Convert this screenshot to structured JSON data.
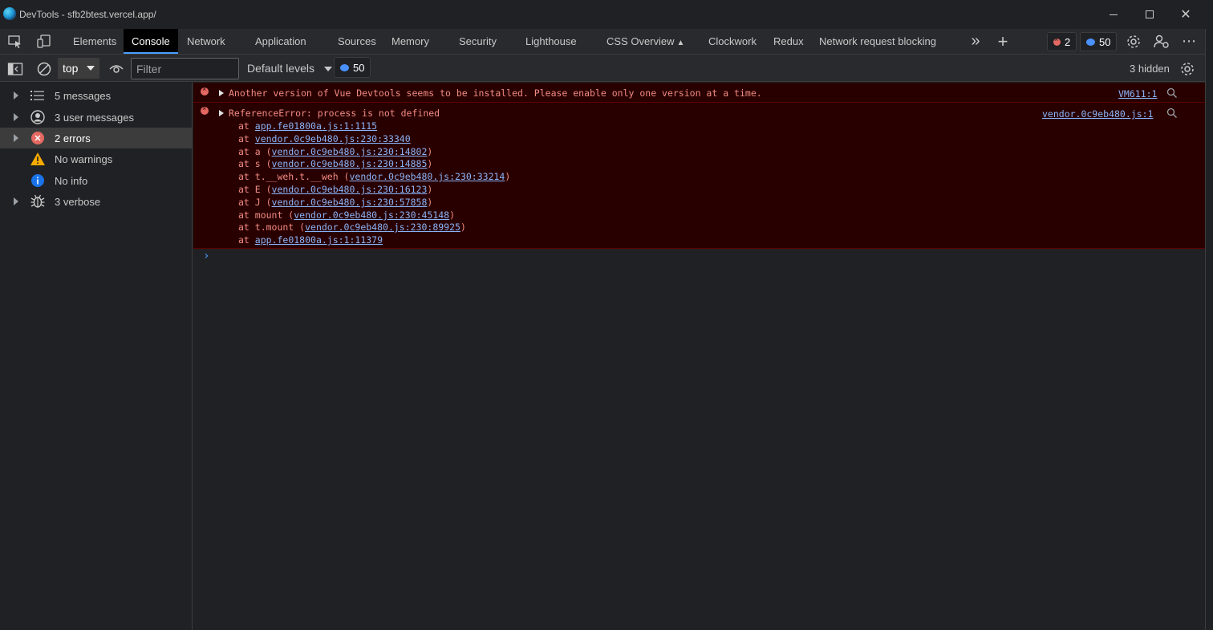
{
  "window": {
    "title": "DevTools - sfb2btest.vercel.app/",
    "minimize_icon": "minimize-icon",
    "maximize_icon": "maximize-icon",
    "close_glyph": "✕"
  },
  "tabs": [
    {
      "label": "Elements",
      "active": false
    },
    {
      "label": "Console",
      "active": true
    },
    {
      "label": "Network",
      "active": false
    },
    {
      "label": "Application",
      "active": false
    },
    {
      "label": "Sources",
      "active": false
    },
    {
      "label": "Memory",
      "active": false
    },
    {
      "label": "Security",
      "active": false
    },
    {
      "label": "Lighthouse",
      "active": false
    },
    {
      "label": "CSS Overview",
      "active": false
    },
    {
      "label": "Clockwork",
      "active": false
    },
    {
      "label": "Redux",
      "active": false
    },
    {
      "label": "Network request blocking",
      "active": false
    }
  ],
  "tabbar": {
    "more_tabs_glyph": "»",
    "add_tab_glyph": "+",
    "error_count": "2",
    "message_count": "50",
    "more_glyph": "⋯"
  },
  "toolbar": {
    "context": "top",
    "filter_placeholder": "Filter",
    "default_levels": "Default levels",
    "message_count": "50",
    "hidden": "3 hidden"
  },
  "sidebar": {
    "items": [
      {
        "label": "5 messages",
        "icon": "list-icon",
        "expandable": true
      },
      {
        "label": "3 user messages",
        "icon": "user-icon",
        "expandable": true
      },
      {
        "label": "2 errors",
        "icon": "error-icon",
        "expandable": true,
        "active": true
      },
      {
        "label": "No warnings",
        "icon": "warning-icon",
        "expandable": false
      },
      {
        "label": "No info",
        "icon": "info-icon",
        "expandable": false
      },
      {
        "label": "3 verbose",
        "icon": "bug-icon",
        "expandable": true
      }
    ]
  },
  "console": {
    "messages": [
      {
        "text": "Another version of Vue Devtools seems to be installed. Please enable only one version at a time.",
        "source": "VM611:1"
      },
      {
        "text": "ReferenceError: process is not defined",
        "source": "vendor.0c9eb480.js:1",
        "stack": [
          {
            "prefix": "at ",
            "link": "app.fe01800a.js:1:1115",
            "suffix": ""
          },
          {
            "prefix": "at ",
            "link": "vendor.0c9eb480.js:230:33340",
            "suffix": ""
          },
          {
            "prefix": "at a (",
            "link": "vendor.0c9eb480.js:230:14802",
            "suffix": ")"
          },
          {
            "prefix": "at s (",
            "link": "vendor.0c9eb480.js:230:14885",
            "suffix": ")"
          },
          {
            "prefix": "at t.__weh.t.__weh (",
            "link": "vendor.0c9eb480.js:230:33214",
            "suffix": ")"
          },
          {
            "prefix": "at E (",
            "link": "vendor.0c9eb480.js:230:16123",
            "suffix": ")"
          },
          {
            "prefix": "at J (",
            "link": "vendor.0c9eb480.js:230:57858",
            "suffix": ")"
          },
          {
            "prefix": "at mount (",
            "link": "vendor.0c9eb480.js:230:45148",
            "suffix": ")"
          },
          {
            "prefix": "at t.mount (",
            "link": "vendor.0c9eb480.js:230:89925",
            "suffix": ")"
          },
          {
            "prefix": "at ",
            "link": "app.fe01800a.js:1:11379",
            "suffix": ""
          }
        ]
      }
    ],
    "prompt_glyph": "›"
  }
}
